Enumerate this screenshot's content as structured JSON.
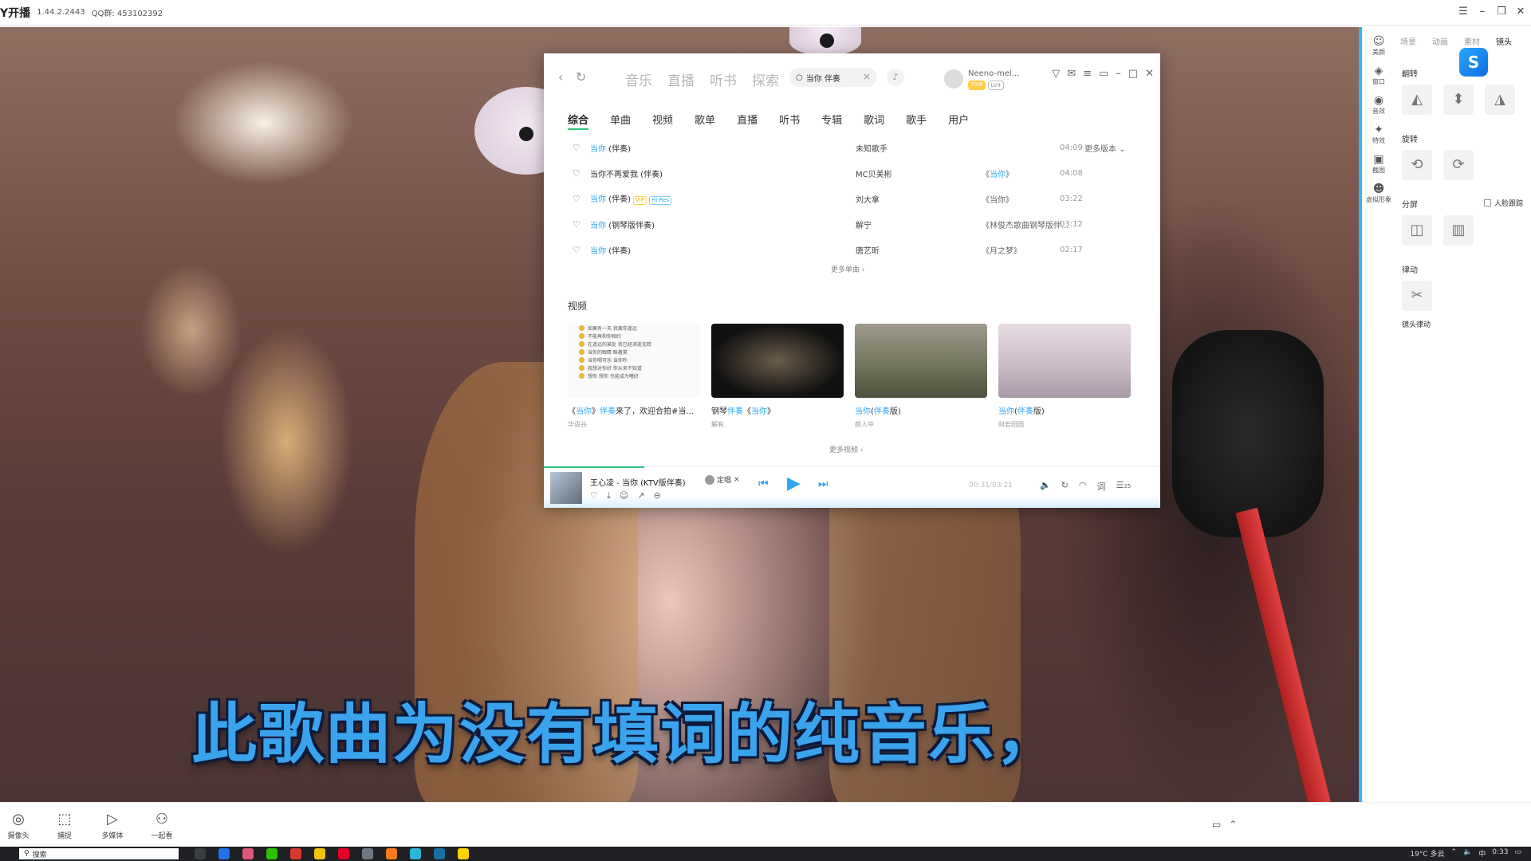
{
  "titlebar": {
    "app_name": "Y开播",
    "version": "1.44.2.2443",
    "qq_group": "QQ群: 453102392",
    "icons": [
      "menu-icon",
      "minimize-icon",
      "restore-icon",
      "close-icon"
    ]
  },
  "subtitle": "此歌曲为没有填词的纯音乐，",
  "music": {
    "nav": [
      "音乐",
      "直播",
      "听书",
      "探索"
    ],
    "search_value": "当你 伴奏",
    "user_name": "Neeno-mel...",
    "badges": [
      "SVIP",
      "LV4"
    ],
    "subtabs": [
      "综合",
      "单曲",
      "视频",
      "歌单",
      "直播",
      "听书",
      "专辑",
      "歌词",
      "歌手",
      "用户"
    ],
    "songs": [
      {
        "hl": "当你",
        "rest": " (伴奏)",
        "tags": [],
        "artist": "未知歌手",
        "album_hl": "",
        "album": "",
        "dur": "04:09",
        "more": "更多版本"
      },
      {
        "hl": "",
        "rest": "当你不再爱我 (伴奏)",
        "tags": [],
        "artist": "MC贝美彬",
        "album_hl": "当你",
        "album": "",
        "dur": "04:08",
        "more": ""
      },
      {
        "hl": "当你",
        "rest": " (伴奏)",
        "tags": [
          "VIP",
          "Hi-Res"
        ],
        "artist": "刘大拿",
        "album_hl": "",
        "album": "《当你》",
        "dur": "03:22",
        "more": ""
      },
      {
        "hl": "当你",
        "rest": " (钢琴版伴奏)",
        "tags": [],
        "artist": "解宁",
        "album_hl": "",
        "album": "《林俊杰歌曲钢琴版伴...",
        "dur": "03:12",
        "more": ""
      },
      {
        "hl": "当你",
        "rest": " (伴奏)",
        "tags": [],
        "artist": "唐艺昕",
        "album_hl": "",
        "album": "《月之梦》",
        "dur": "02:17",
        "more": ""
      }
    ],
    "more_songs": "更多单曲 ›",
    "video_section": "视频",
    "thumb_lines": [
      "如果有一天 我离你遥远",
      "不能再和你相约",
      "在遥远的某处 我已经消逝无踪",
      "当你的眼睛 眯着笑",
      "当你喝可乐 当你吵",
      "我想对你好 你从来不知道",
      "想你 想你 也能成为嗜好"
    ],
    "videos": [
      {
        "pre": "《",
        "hl": "当你",
        "mid": "》",
        "hl2": "伴奏",
        "post": "来了，欢迎合拍#当...",
        "sub": "华语谷"
      },
      {
        "pre": "钢琴",
        "hl": "伴奏",
        "mid": "《",
        "hl2": "当你",
        "post": "》",
        "sub": "解有"
      },
      {
        "pre": "",
        "hl": "当你",
        "mid": "(",
        "hl2": "伴奏",
        "post": "版)",
        "sub": "颜人中"
      },
      {
        "pre": "",
        "hl": "当你",
        "mid": "(",
        "hl2": "伴奏",
        "post": "版)",
        "sub": "财若田园"
      }
    ],
    "more_videos": "更多视频 ›",
    "player": {
      "now_playing": "王心凌 - 当你 (KTV版伴奏)",
      "singer_chip": "定唱",
      "time": "00:31/03:21",
      "quality": "25"
    }
  },
  "rightnav": [
    "美颜",
    "窗口",
    "音效",
    "特效",
    "截图",
    "虚拟形象"
  ],
  "panel": {
    "tabs": [
      "场景",
      "动画",
      "素材",
      "镜头"
    ],
    "flip": "翻转",
    "rotate": "旋转",
    "split": "分屏",
    "face_follow": "人脸跟踪",
    "shake": "律动",
    "shake_btn": "镜头律动"
  },
  "toolbar": [
    "摄像头",
    "捕捉",
    "多媒体",
    "一起看"
  ],
  "taskbar": {
    "search": "搜索",
    "weather": "19°C 多云",
    "ime": "中",
    "time": "0:33"
  }
}
